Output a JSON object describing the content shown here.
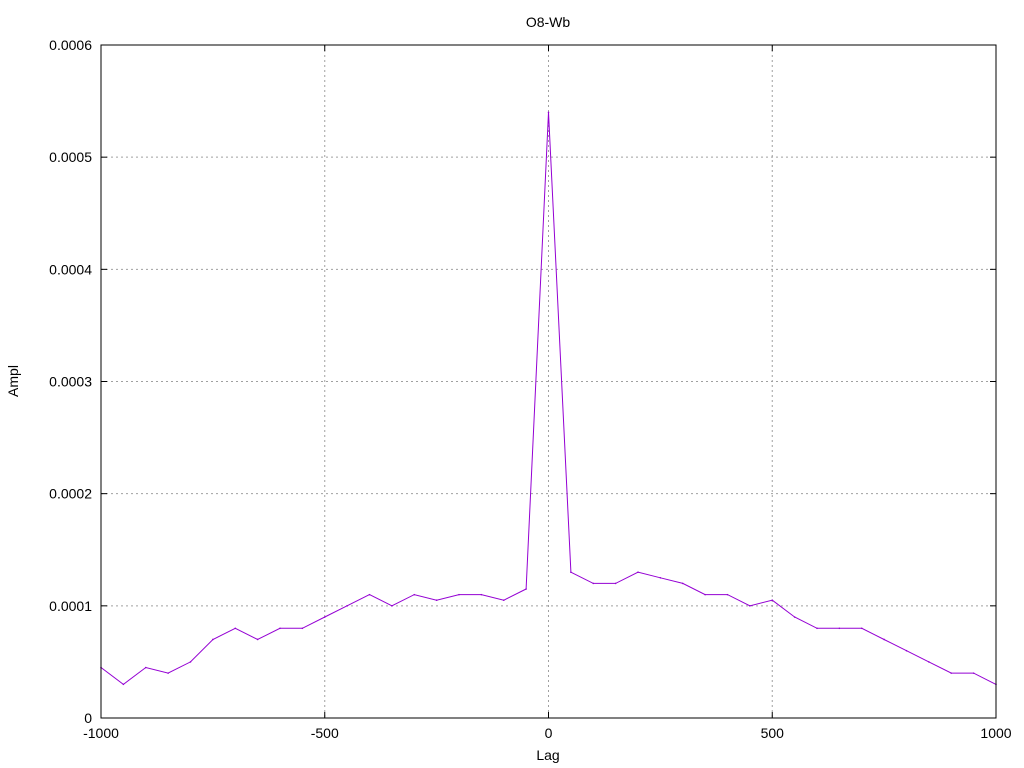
{
  "chart_data": {
    "type": "line",
    "title": "O8-Wb",
    "xlabel": "Lag",
    "ylabel": "Ampl",
    "xlim": [
      -1000,
      1000
    ],
    "ylim": [
      0,
      0.0006
    ],
    "grid": true,
    "x_ticks": [
      -1000,
      -500,
      0,
      500,
      1000
    ],
    "x_tick_labels": [
      "-1000",
      "-500",
      "0",
      "500",
      "1000"
    ],
    "y_ticks": [
      0,
      0.0001,
      0.0002,
      0.0003,
      0.0004,
      0.0005,
      0.0006
    ],
    "y_tick_labels": [
      "0",
      "0.0001",
      "0.0002",
      "0.0003",
      "0.0004",
      "0.0005",
      "0.0006"
    ],
    "colors": {
      "series": "#9400d3"
    },
    "series": [
      {
        "color": "#9400d3",
        "x": [
          -1000,
          -950,
          -900,
          -850,
          -800,
          -750,
          -700,
          -650,
          -600,
          -550,
          -500,
          -450,
          -400,
          -350,
          -300,
          -250,
          -200,
          -150,
          -100,
          -50,
          0,
          50,
          100,
          150,
          200,
          250,
          300,
          350,
          400,
          450,
          500,
          550,
          600,
          650,
          700,
          750,
          800,
          850,
          900,
          950,
          1000
        ],
        "values": [
          4.5e-05,
          3e-05,
          4.5e-05,
          4e-05,
          5e-05,
          7e-05,
          8e-05,
          7e-05,
          8e-05,
          8e-05,
          9e-05,
          0.0001,
          0.00011,
          0.0001,
          0.00011,
          0.000105,
          0.00011,
          0.00011,
          0.000105,
          0.000115,
          0.00054,
          0.00013,
          0.00012,
          0.00012,
          0.00013,
          0.000125,
          0.00012,
          0.00011,
          0.00011,
          0.0001,
          0.000105,
          9e-05,
          8e-05,
          8e-05,
          8e-05,
          7e-05,
          6e-05,
          5e-05,
          4e-05,
          4e-05,
          3e-05
        ]
      }
    ]
  }
}
